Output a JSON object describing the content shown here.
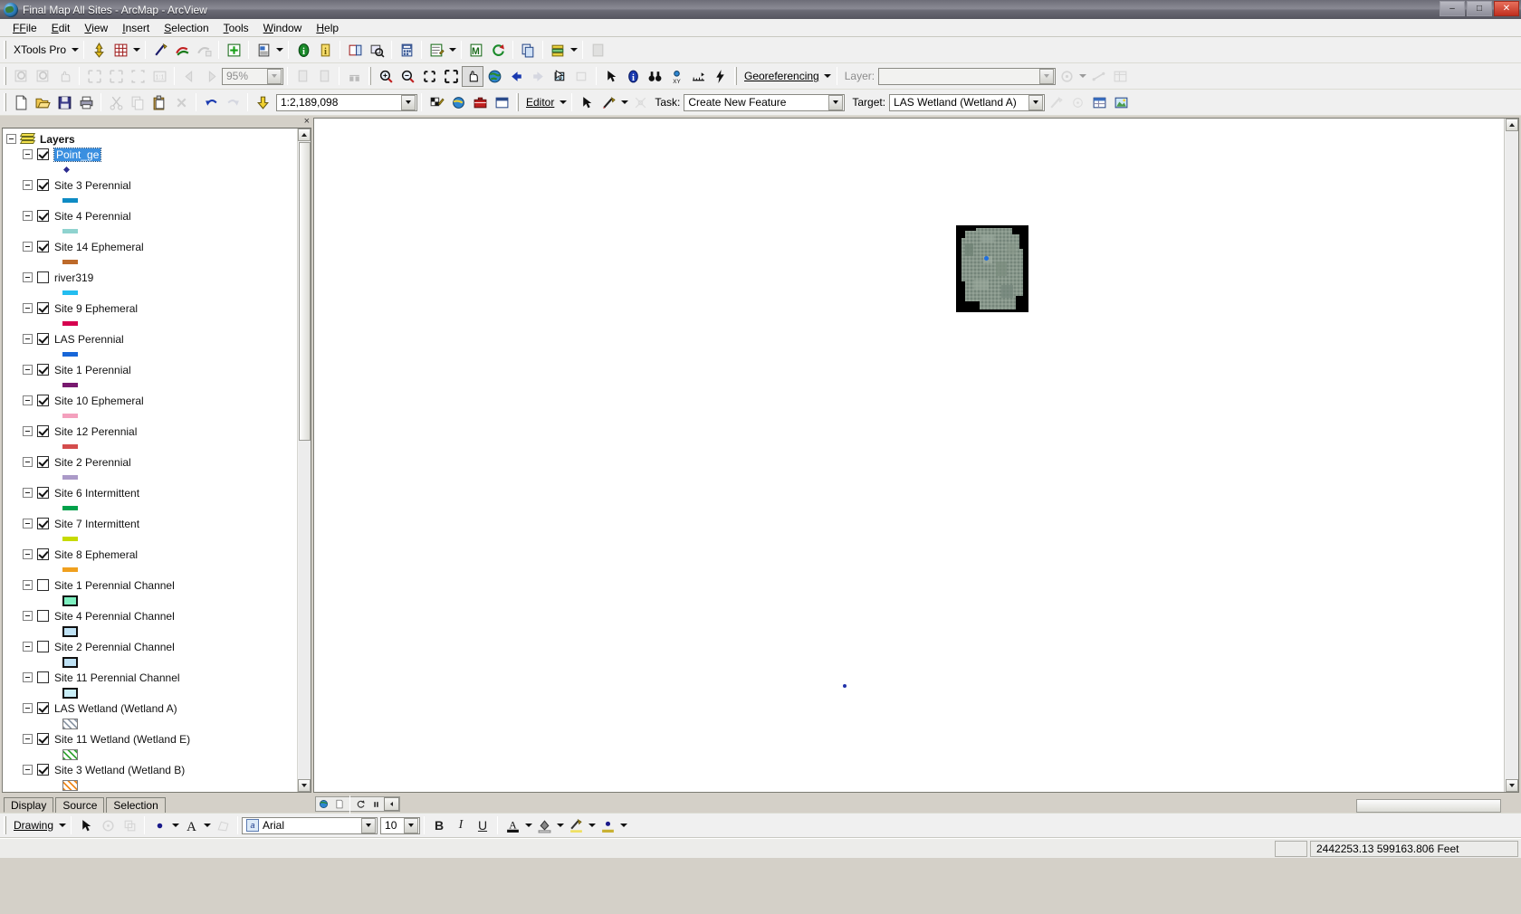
{
  "window": {
    "title": "Final Map All Sites - ArcMap - ArcView",
    "app_icon": "arcmap-globe-icon",
    "minimize": "–",
    "maximize": "□",
    "close": "✕"
  },
  "menubar": {
    "items": [
      {
        "label": "File",
        "accel": "F"
      },
      {
        "label": "Edit",
        "accel": "E"
      },
      {
        "label": "View",
        "accel": "V"
      },
      {
        "label": "Insert",
        "accel": "I"
      },
      {
        "label": "Selection",
        "accel": "S"
      },
      {
        "label": "Tools",
        "accel": "T"
      },
      {
        "label": "Window",
        "accel": "W"
      },
      {
        "label": "Help",
        "accel": "H"
      }
    ]
  },
  "xtools_toolbar": {
    "menu_label": "XTools Pro",
    "buttons": [
      "add-point-icon",
      "table-grid-icon",
      "pencil-edit-icon",
      "shape-convert-icon",
      "shape-convert-disabled-icon",
      "add-feature-icon",
      "layer-report-icon",
      "info-green-icon",
      "info-yellow-icon",
      "attribute-table-icon",
      "zoom-selection-icon",
      "calculator-icon",
      "edit-table-icon",
      "merge-icon",
      "refresh-sync-icon",
      "copy-layers-icon",
      "layer-stack-icon",
      "paste-disabled-icon"
    ]
  },
  "layout_toolbar": {
    "zoom_value": "95%",
    "buttons": [
      "layout-zoom-in-icon",
      "layout-zoom-out-icon",
      "layout-pan-icon",
      "fixed-zoom-in-icon",
      "fixed-zoom-out-icon",
      "zoom-whole-page-icon",
      "zoom-100-icon",
      "go-back-extent-icon",
      "go-forward-extent-icon",
      "toggle-draft-icon",
      "focus-data-frame-icon",
      "change-layout-icon"
    ]
  },
  "tools_toolbar": {
    "buttons": [
      "zoom-in-icon",
      "zoom-out-icon",
      "fixed-zoom-in-icon",
      "fixed-zoom-out-icon",
      "pan-hand-icon",
      "full-extent-globe-icon",
      "go-back-extent-icon",
      "go-forward-extent-icon",
      "select-features-icon",
      "clear-selection-icon",
      "select-elements-arrow-icon",
      "identify-icon",
      "find-binoculars-icon",
      "go-to-xy-icon",
      "measure-icon",
      "hyperlink-lightning-icon"
    ]
  },
  "georeferencing_toolbar": {
    "menu_label": "Georeferencing",
    "layer_label": "Layer:",
    "layer_value": "",
    "buttons": [
      "rotate-icon",
      "shift-icon",
      "scale-icon",
      "view-link-table-icon"
    ]
  },
  "standard_toolbar": {
    "scale_value": "1:2,189,098",
    "buttons": [
      "new-document-icon",
      "open-folder-icon",
      "save-disk-icon",
      "print-icon",
      "cut-scissors-icon",
      "copy-icon",
      "paste-icon",
      "delete-x-icon",
      "undo-icon",
      "redo-icon",
      "add-data-icon",
      "editor-toolbar-icon",
      "map-tips-icon",
      "toolbox-icon",
      "command-line-icon",
      "model-builder-icon"
    ]
  },
  "editor_toolbar": {
    "menu_label": "Editor",
    "task_label": "Task:",
    "task_value": "Create New Feature",
    "target_label": "Target:",
    "target_value": "LAS Wetland (Wetland A)",
    "buttons": [
      "edit-arrow-icon",
      "sketch-pencil-icon",
      "split-tool-icon",
      "attributes-icon",
      "sketch-properties-icon",
      "table-window-icon",
      "show-image-icon"
    ]
  },
  "toc": {
    "close_label": "×",
    "root": {
      "label": "Layers",
      "icon": "layers-stack-icon",
      "expanded": true
    },
    "layers": [
      {
        "name": "Point_ge",
        "checked": true,
        "selected": true,
        "symbol": "point",
        "color": "#2b2b8f"
      },
      {
        "name": "Site 3 Perennial",
        "checked": true,
        "selected": false,
        "symbol": "line",
        "color": "#0e8bc4"
      },
      {
        "name": "Site 4 Perennial",
        "checked": true,
        "selected": false,
        "symbol": "line",
        "color": "#8fd3cf"
      },
      {
        "name": "Site 14 Ephemeral",
        "checked": true,
        "selected": false,
        "symbol": "line",
        "color": "#bd6a2a"
      },
      {
        "name": "river319",
        "checked": false,
        "selected": false,
        "symbol": "line",
        "color": "#23bdf0"
      },
      {
        "name": "Site 9 Ephemeral",
        "checked": true,
        "selected": false,
        "symbol": "line",
        "color": "#d6004f"
      },
      {
        "name": "LAS Perennial",
        "checked": true,
        "selected": false,
        "symbol": "line",
        "color": "#1766d8"
      },
      {
        "name": "Site 1 Perennial",
        "checked": true,
        "selected": false,
        "symbol": "line",
        "color": "#78196f"
      },
      {
        "name": "Site 10 Ephemeral",
        "checked": true,
        "selected": false,
        "symbol": "line",
        "color": "#f4a0bd"
      },
      {
        "name": "Site 12 Perennial",
        "checked": true,
        "selected": false,
        "symbol": "line",
        "color": "#d44c4c"
      },
      {
        "name": "Site 2 Perennial",
        "checked": true,
        "selected": false,
        "symbol": "line",
        "color": "#ab9ac8"
      },
      {
        "name": "Site 6 Intermittent",
        "checked": true,
        "selected": false,
        "symbol": "line",
        "color": "#00a14b"
      },
      {
        "name": "Site 7 Intermittent",
        "checked": true,
        "selected": false,
        "symbol": "line",
        "color": "#c6da00"
      },
      {
        "name": "Site 8 Ephemeral",
        "checked": true,
        "selected": false,
        "symbol": "line",
        "color": "#f0a01e"
      },
      {
        "name": "Site 1 Perennial Channel",
        "checked": false,
        "selected": false,
        "symbol": "box",
        "color": "#7df0c0"
      },
      {
        "name": "Site 4 Perennial Channel",
        "checked": false,
        "selected": false,
        "symbol": "box",
        "color": "#bfe2f5"
      },
      {
        "name": "Site 2 Perennial Channel",
        "checked": false,
        "selected": false,
        "symbol": "box",
        "color": "#bfe2f5"
      },
      {
        "name": "Site 11 Perennial Channel",
        "checked": false,
        "selected": false,
        "symbol": "box",
        "color": "#c9eef7"
      },
      {
        "name": "LAS Wetland (Wetland A)",
        "checked": true,
        "selected": false,
        "symbol": "hatch",
        "color": "#8f9aa8"
      },
      {
        "name": "Site 11 Wetland (Wetland E)",
        "checked": true,
        "selected": false,
        "symbol": "hatch",
        "color": "#35a735"
      },
      {
        "name": "Site 3 Wetland (Wetland B)",
        "checked": true,
        "selected": false,
        "symbol": "hatch",
        "color": "#f08a1e"
      }
    ],
    "tabs": [
      {
        "label": "Display",
        "active": true
      },
      {
        "label": "Source",
        "active": false
      },
      {
        "label": "Selection",
        "active": false
      }
    ],
    "draw_strip": [
      "globe-draw-icon",
      "page-draw-icon",
      "refresh-icon",
      "pause-icon",
      "collapse-icon"
    ]
  },
  "map": {
    "background": "#ffffff",
    "raster_name": "aerial-imagery-raster",
    "point_features": [
      {
        "name": "selected-point",
        "color": "#1f6fe0"
      },
      {
        "name": "map-point-feature",
        "color": "#2233aa"
      }
    ]
  },
  "drawing_toolbar": {
    "menu_label": "Drawing",
    "font_name": "Arial",
    "font_size": "10",
    "bold": "B",
    "italic": "I",
    "underline": "U",
    "buttons": [
      "select-elements-arrow-icon",
      "rotate-element-icon",
      "group-elements-icon",
      "new-marker-icon",
      "new-text-icon",
      "edit-vertices-icon",
      "font-color-icon",
      "fill-color-icon",
      "line-color-icon",
      "marker-color-icon"
    ]
  },
  "statusbar": {
    "coordinates": "2442253.13  599163.806 Feet"
  }
}
